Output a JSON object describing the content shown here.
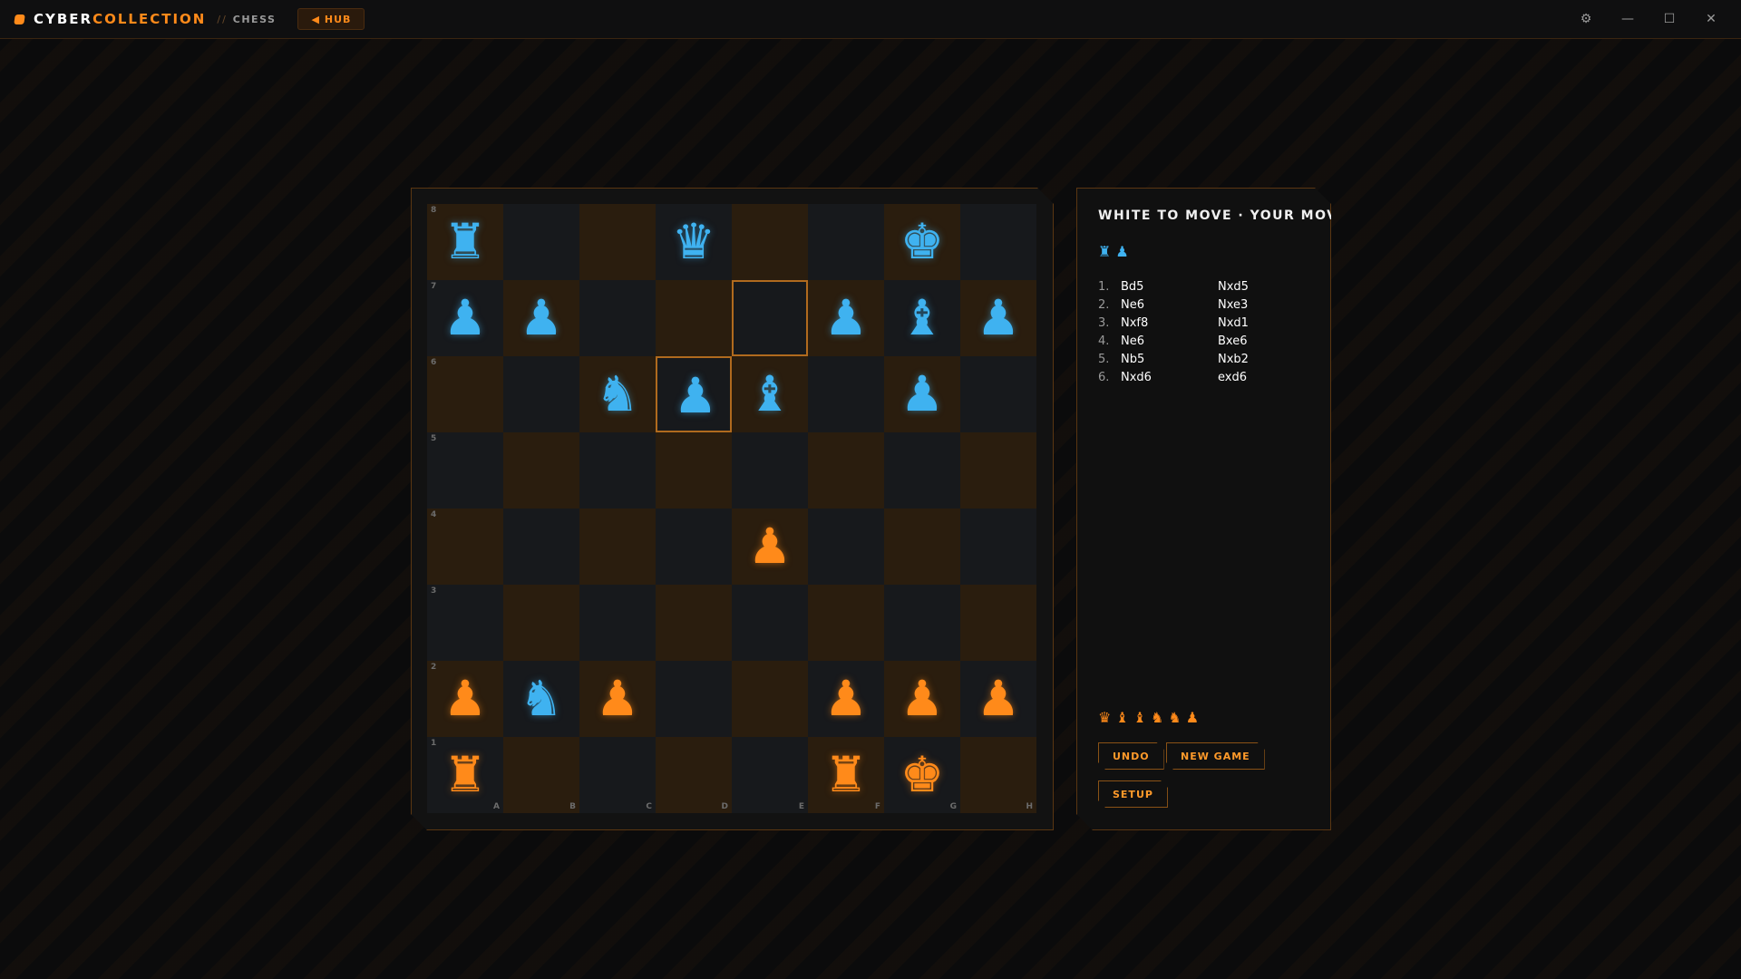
{
  "app": {
    "brand_part1": "CYBER",
    "brand_part2": "COLLECTION",
    "separator": "//",
    "section": "CHESS",
    "hub_label": "HUB",
    "hub_icon": "◀",
    "accent_color": "#ff8a1a",
    "secondary_color": "#3fb2f0"
  },
  "window_controls": {
    "settings": "⚙",
    "minimize": "—",
    "maximize": "☐",
    "close": "✕"
  },
  "board": {
    "files": [
      "A",
      "B",
      "C",
      "D",
      "E",
      "F",
      "G",
      "H"
    ],
    "ranks": [
      "8",
      "7",
      "6",
      "5",
      "4",
      "3",
      "2",
      "1"
    ],
    "highlighted_squares": [
      "e7",
      "d6"
    ],
    "pieces": [
      {
        "square": "a8",
        "glyph": "♜",
        "side": "blue",
        "name": "rook"
      },
      {
        "square": "d8",
        "glyph": "♛",
        "side": "blue",
        "name": "queen"
      },
      {
        "square": "g8",
        "glyph": "♚",
        "side": "blue",
        "name": "king"
      },
      {
        "square": "a7",
        "glyph": "♟",
        "side": "blue",
        "name": "pawn"
      },
      {
        "square": "b7",
        "glyph": "♟",
        "side": "blue",
        "name": "pawn"
      },
      {
        "square": "f7",
        "glyph": "♟",
        "side": "blue",
        "name": "pawn"
      },
      {
        "square": "g7",
        "glyph": "♝",
        "side": "blue",
        "name": "bishop"
      },
      {
        "square": "h7",
        "glyph": "♟",
        "side": "blue",
        "name": "pawn"
      },
      {
        "square": "c6",
        "glyph": "♞",
        "side": "blue",
        "name": "knight"
      },
      {
        "square": "d6",
        "glyph": "♟",
        "side": "blue",
        "name": "pawn"
      },
      {
        "square": "e6",
        "glyph": "♝",
        "side": "blue",
        "name": "bishop"
      },
      {
        "square": "g6",
        "glyph": "♟",
        "side": "blue",
        "name": "pawn"
      },
      {
        "square": "e4",
        "glyph": "♟",
        "side": "orange",
        "name": "pawn"
      },
      {
        "square": "a2",
        "glyph": "♟",
        "side": "orange",
        "name": "pawn"
      },
      {
        "square": "b2",
        "glyph": "♞",
        "side": "blue",
        "name": "knight"
      },
      {
        "square": "c2",
        "glyph": "♟",
        "side": "orange",
        "name": "pawn"
      },
      {
        "square": "f2",
        "glyph": "♟",
        "side": "orange",
        "name": "pawn"
      },
      {
        "square": "g2",
        "glyph": "♟",
        "side": "orange",
        "name": "pawn"
      },
      {
        "square": "h2",
        "glyph": "♟",
        "side": "orange",
        "name": "pawn"
      },
      {
        "square": "a1",
        "glyph": "♜",
        "side": "orange",
        "name": "rook"
      },
      {
        "square": "f1",
        "glyph": "♜",
        "side": "orange",
        "name": "rook"
      },
      {
        "square": "g1",
        "glyph": "♚",
        "side": "orange",
        "name": "king"
      }
    ]
  },
  "side": {
    "status": "WHITE TO MOVE · YOUR MOVE",
    "captured_top": [
      {
        "glyph": "♜",
        "side": "blue",
        "name": "rook"
      },
      {
        "glyph": "♟",
        "side": "blue",
        "name": "pawn"
      }
    ],
    "moves": [
      {
        "num": "1.",
        "white": "Bd5",
        "black": "Nxd5"
      },
      {
        "num": "2.",
        "white": "Ne6",
        "black": "Nxe3"
      },
      {
        "num": "3.",
        "white": "Nxf8",
        "black": "Nxd1"
      },
      {
        "num": "4.",
        "white": "Ne6",
        "black": "Bxe6"
      },
      {
        "num": "5.",
        "white": "Nb5",
        "black": "Nxb2"
      },
      {
        "num": "6.",
        "white": "Nxd6",
        "black": "exd6"
      }
    ],
    "captured_bottom": [
      {
        "glyph": "♛",
        "side": "orange",
        "name": "queen"
      },
      {
        "glyph": "♝",
        "side": "orange",
        "name": "bishop"
      },
      {
        "glyph": "♝",
        "side": "orange",
        "name": "bishop"
      },
      {
        "glyph": "♞",
        "side": "orange",
        "name": "knight"
      },
      {
        "glyph": "♞",
        "side": "orange",
        "name": "knight"
      },
      {
        "glyph": "♟",
        "side": "orange",
        "name": "pawn"
      }
    ],
    "buttons": {
      "undo": "UNDO",
      "new_game": "NEW GAME",
      "setup": "SETUP"
    }
  }
}
